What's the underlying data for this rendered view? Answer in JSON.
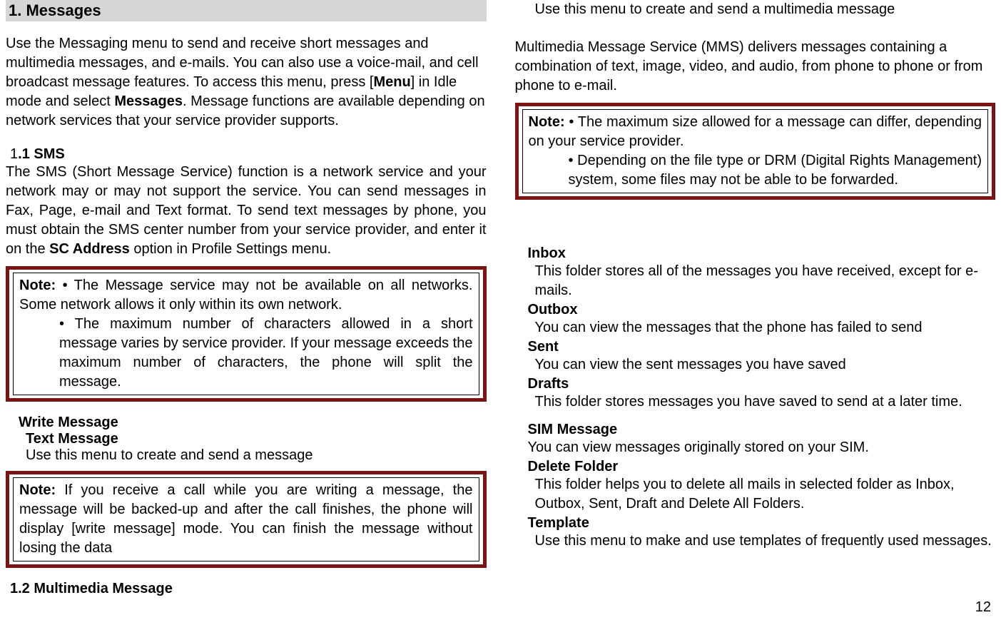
{
  "left": {
    "section_title": "1. Messages",
    "intro_p1": "Use the Messaging menu to send and receive short messages and multimedia messages, and e-mails. You can also use a voice-mail, and cell broadcast message features. To access this menu, press [",
    "intro_menu": "Menu",
    "intro_p2": "] in Idle mode and select ",
    "intro_messages": "Messages",
    "intro_p3": ". Message functions are available depending on network services that your service provider supports.",
    "sms_num": "1",
    "sms_heading": ".1 SMS",
    "sms_body_p1": "The SMS (Short Message Service) function is a network service and your network may or may not support the service. You can send messages in Fax, Page, e-mail and Text format. To send text messages by phone, you must obtain the SMS center number from your service provider, and enter it on the ",
    "sms_body_sc": "SC Address",
    "sms_body_p2": " option in Profile Settings menu.",
    "note1_label": "Note:",
    "note1_line1": " • The Message service may not be available on all networks. Some network allows it only within its own network.",
    "note1_line2": "• The maximum number of characters allowed in a short message varies by service provider. If your message exceeds the maximum number of characters, the phone will split the message.",
    "write_msg": "Write Message",
    "text_msg": "Text Message",
    "text_msg_desc": "Use this menu to create and send a message",
    "note2_label": "Note:",
    "note2_body": " If you receive a call while you are writing a message, the message will be backed-up and after the call finishes, the phone will display [write message] mode. You can finish the message without losing the data",
    "mm_heading": "1.2 Multimedia Message"
  },
  "right": {
    "mm_desc": "Use this menu to create and send a multimedia message",
    "mms_para": "Multimedia Message Service (MMS) delivers messages containing a combination of text, image, video, and audio, from phone to phone or from phone to e-mail.",
    "note3_label": "Note:",
    "note3_line1": " • The maximum size allowed for a message can differ, depending on your service provider.",
    "note3_line2": "• Depending on the file type or DRM (Digital Rights Management) system, some files may not be able to be forwarded.",
    "folders": {
      "inbox_t": "Inbox",
      "inbox_d": "This folder stores all of the messages you have received, except for e-mails.",
      "outbox_t": "Outbox",
      "outbox_d": "You can view the messages that the phone has failed to send",
      "sent_t": "Sent",
      "sent_d": "You can view the sent messages you have saved",
      "drafts_t": "Drafts",
      "drafts_d": "This folder stores messages you have saved to send at a later time.",
      "sim_t": "SIM Message",
      "sim_d": "You can view messages originally stored on your SIM.",
      "del_t": "Delete Folder",
      "del_d": "This folder helps you to delete all mails in selected folder as Inbox, Outbox, Sent, Draft and Delete All Folders.",
      "tpl_t": "Template",
      "tpl_d": "Use this menu to make and use templates of frequently used messages."
    }
  },
  "page_number": "12"
}
